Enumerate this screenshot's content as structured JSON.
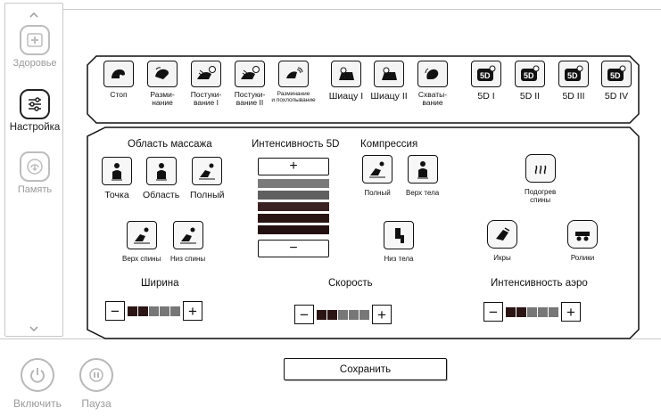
{
  "sidebar": {
    "items": [
      {
        "label": "Здоровье",
        "icon": "health-icon",
        "active": false
      },
      {
        "label": "Настройка",
        "icon": "settings-sliders-icon",
        "active": true
      },
      {
        "label": "Память",
        "icon": "memory-icon",
        "active": false
      }
    ]
  },
  "bottom": {
    "power_label": "Включить",
    "pause_label": "Пауза"
  },
  "modes": [
    {
      "label": "Стоп"
    },
    {
      "label": "Разми-\nнание"
    },
    {
      "label": "Постуки-\nвание I"
    },
    {
      "label": "Постуки-\nвание II"
    },
    {
      "label": "Разминание\nи похлопывание"
    },
    {
      "label": "Шиацу I"
    },
    {
      "label": "Шиацу II"
    },
    {
      "label": "Схваты-\nвание"
    },
    {
      "label": "5D I",
      "icon_text": "5D"
    },
    {
      "label": "5D II",
      "icon_text": "5D"
    },
    {
      "label": "5D III",
      "icon_text": "5D"
    },
    {
      "label": "5D IV",
      "icon_text": "5D"
    }
  ],
  "area": {
    "title": "Область массажа",
    "options": [
      {
        "label": "Точка"
      },
      {
        "label": "Область"
      },
      {
        "label": "Полный"
      },
      {
        "label": "Верх спины"
      },
      {
        "label": "Низ спины"
      }
    ]
  },
  "intensity5d": {
    "title": "Интенсивность 5D",
    "plus": "+",
    "minus": "−",
    "levels": 5,
    "active": 5,
    "colors": [
      "#7a7a7a",
      "#5f5f5f",
      "#3a2222",
      "#2a1515",
      "#241010"
    ]
  },
  "compression": {
    "title": "Компрессия",
    "options": [
      {
        "label": "Полный"
      },
      {
        "label": "Верх тела"
      },
      {
        "label": "Низ тела"
      }
    ]
  },
  "extras": [
    {
      "label": "Подогрев\nспины"
    },
    {
      "label": "Икры"
    },
    {
      "label": "Ролики"
    }
  ],
  "sliders": {
    "width": {
      "title": "Ширина",
      "value": 2,
      "max": 5
    },
    "speed": {
      "title": "Скорость",
      "value": 2,
      "max": 5
    },
    "air": {
      "title": "Интенсивность аэро",
      "value": 2,
      "max": 5
    }
  },
  "save_label": "Сохранить",
  "colors": {
    "active_cell": "#2a1414",
    "inactive_cell": "#777777",
    "frame": "#c9c9c9"
  }
}
